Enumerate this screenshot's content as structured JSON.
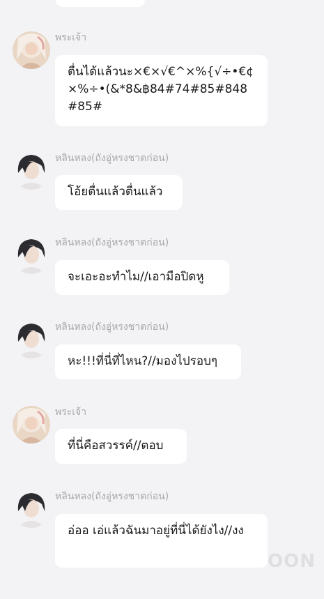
{
  "messages": [
    {
      "sender": "พระเจ้า",
      "avatar": "god-avatar",
      "text": "ตื่นได้แล้วนะ×€×√€^×%{√÷•€¢×%÷•(&*8&฿84#74#85#848#85#"
    },
    {
      "sender": "หลินหลง(ถังอู่หรงชาตก่อน)",
      "avatar": "linlong-avatar",
      "text": "โอ้ยตื่นแล้วตื่นแล้ว"
    },
    {
      "sender": "หลินหลง(ถังอู่หรงชาตก่อน)",
      "avatar": "linlong-avatar",
      "text": "จะเอะอะทำไม//เอามือปิดหู"
    },
    {
      "sender": "หลินหลง(ถังอู่หรงชาตก่อน)",
      "avatar": "linlong-avatar",
      "text": "หะ!!!ที่นี่ที่ไหน?//มองไปรอบๆ"
    },
    {
      "sender": "พระเจ้า",
      "avatar": "god-avatar",
      "text": "ที่นี่คือสวรรค์//ตอบ"
    },
    {
      "sender": "หลินหลง(ถังอู่หรงชาตก่อน)",
      "avatar": "linlong-avatar",
      "text": "อ่ออ เอ่แล้วฉันมาอยู่ที่นี่ได้ยังไง//งง"
    }
  ],
  "watermark": "OON"
}
